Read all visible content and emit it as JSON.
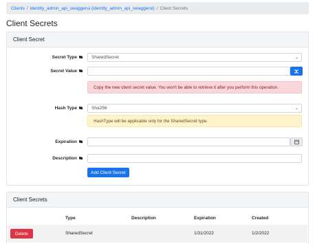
{
  "breadcrumb": {
    "items": [
      "Clients",
      "identity_admin_api_swaggerui (identity_admin_api_swaggerui)",
      "Client Secrets"
    ],
    "separator": "/"
  },
  "page_title": "Client Secrets",
  "form_card": {
    "header": "Client Secret",
    "secret_type": {
      "label": "Secret Type",
      "value": "SharedSecret"
    },
    "secret_value": {
      "label": "Secret Value",
      "value": ""
    },
    "copy_alert": "Copy the new client secret value. You won't be able to retrieve it after you perform this operation.",
    "hash_type": {
      "label": "Hash Type",
      "value": "Sha256"
    },
    "hash_alert": "HashType will be applicable only for the SharedSecret type.",
    "expiration": {
      "label": "Expiration",
      "value": ""
    },
    "description": {
      "label": "Description",
      "value": ""
    },
    "add_button": "Add Client Secret"
  },
  "table_card": {
    "header": "Client Secrets",
    "columns": [
      "Type",
      "Description",
      "Expiration",
      "Created"
    ],
    "rows": [
      {
        "action": "Delete",
        "type": "SharedSecret",
        "description": "",
        "expiration": "1/31/2022",
        "created": "1/2/2022"
      }
    ]
  },
  "colors": {
    "primary": "#1a73e8",
    "danger": "#dc3545",
    "alert_danger_bg": "#f8d7da",
    "alert_warning_bg": "#fff3cd"
  }
}
